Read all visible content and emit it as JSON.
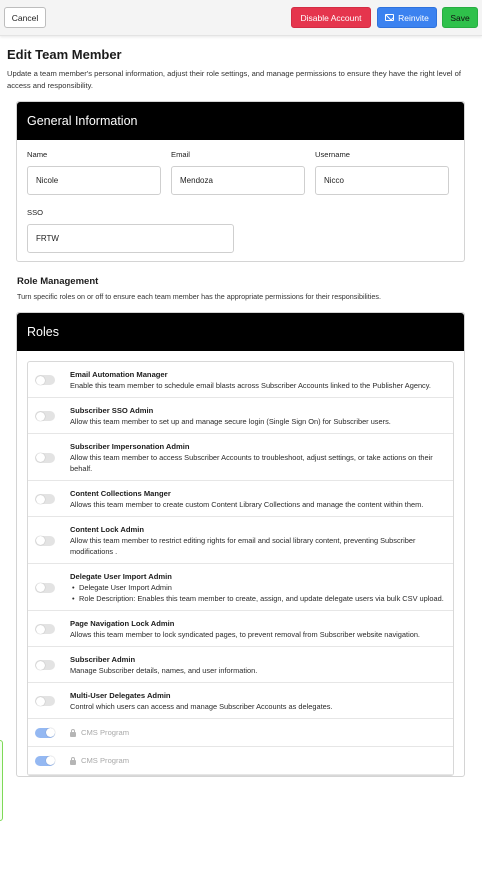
{
  "toolbar": {
    "cancel_label": "Cancel",
    "disable_label": "Disable Account",
    "reinvite_label": "Reinvite",
    "save_label": "Save"
  },
  "page": {
    "title": "Edit Team Member",
    "description": "Update a team member's personal information, adjust their role settings, and manage permissions to ensure they have the right level of access and responsibility."
  },
  "general": {
    "header": "General Information",
    "fields": [
      {
        "label": "Name",
        "value": "Nicole"
      },
      {
        "label": "Email",
        "value": "Mendoza"
      },
      {
        "label": "Username",
        "value": "Nicco"
      }
    ],
    "sso": {
      "label": "SSO",
      "value": "FRTW"
    }
  },
  "role_management": {
    "title": "Role Management",
    "description": "Turn specific roles on or off to ensure each team member has the appropriate permissions for their responsibilities."
  },
  "roles": {
    "header": "Roles",
    "items": [
      {
        "name": "Email Automation Manager",
        "description": "Enable this team member to schedule email blasts across Subscriber Accounts linked to the Publisher Agency.",
        "enabled": false
      },
      {
        "name": "Subscriber SSO Admin",
        "description": "Allow this team member to set up and manage secure login (Single Sign On) for Subscriber users.",
        "enabled": false
      },
      {
        "name": "Subscriber Impersonation Admin",
        "description": "Allow this team member to access Subscriber Accounts to troubleshoot, adjust settings, or take actions on their behalf.",
        "enabled": false
      },
      {
        "name": "Content Collections Manger",
        "description": "Allows this team member to create custom Content Library Collections and manage the content within them.",
        "enabled": false
      },
      {
        "name": "Content Lock Admin",
        "description": "Allow this team member to restrict editing rights for email and social library content, preventing Subscriber modifications .",
        "enabled": false
      },
      {
        "name": "Delegate User Import Admin",
        "bullets": [
          "Delegate User Import Admin",
          "Role Description: Enables this team member to create, assign, and update delegate users via bulk CSV upload."
        ],
        "enabled": false
      },
      {
        "name": "Page Navigation Lock Admin",
        "description": "Allows this team member to lock syndicated pages, to prevent removal from Subscriber website navigation.",
        "enabled": false
      },
      {
        "name": "Subscriber Admin",
        "description": "Manage Subscriber details, names, and user information.",
        "enabled": false
      },
      {
        "name": "Multi-User Delegates Admin",
        "description": "Control which users can access and manage Subscriber Accounts as delegates.",
        "enabled": false
      }
    ],
    "locked_programs": [
      {
        "label": "CMS Program",
        "enabled": true
      },
      {
        "label": "CMS Program",
        "enabled": true
      }
    ]
  },
  "colors": {
    "disable": "#e5354d",
    "reinvite": "#3b82f0",
    "save": "#2fc14b",
    "header_bg": "#000000",
    "toggle_on": "#94b8f2"
  }
}
